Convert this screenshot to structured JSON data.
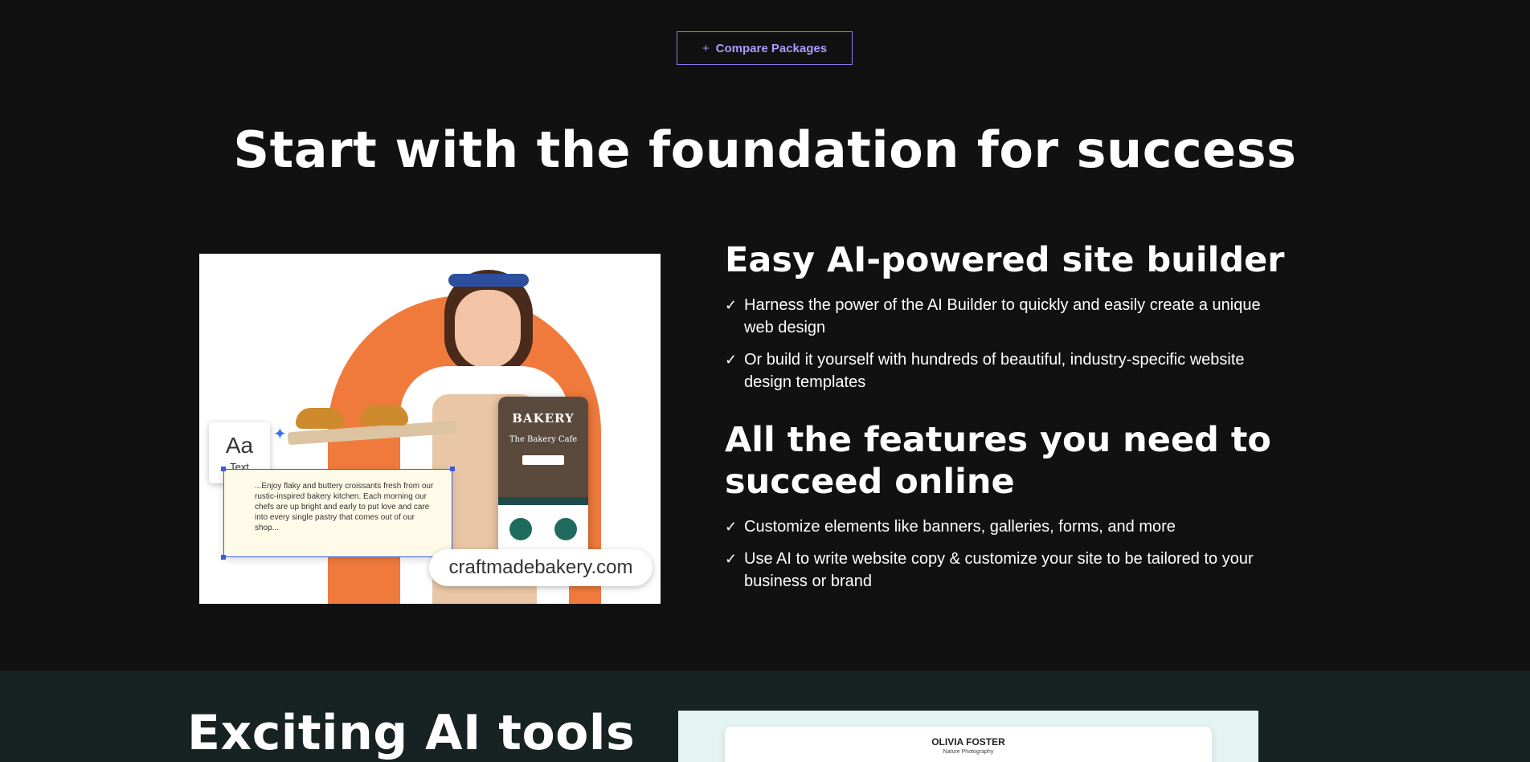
{
  "top_button": {
    "icon": "+",
    "label": "Compare Packages"
  },
  "hero": {
    "title": "Start with the foundation for success"
  },
  "image": {
    "text_tool_glyph": "Aa",
    "text_tool_label": "Text",
    "copy_text": "...Enjoy flaky and buttery croissants fresh from our rustic-inspired bakery kitchen. Each morning our chefs are up bright and early to put love and care into every single pastry that comes out of our shop...",
    "phone_brand": "BAKERY",
    "phone_sub": "The Bakery Cafe",
    "domain": "craftmadebakery.com"
  },
  "section1": {
    "heading": "Easy AI-powered site builder",
    "items": [
      "Harness the power of the AI Builder to quickly and easily create a unique web design",
      "Or build it yourself with hundreds of beautiful, industry-specific website design templates"
    ]
  },
  "section2": {
    "heading_line1": "All the features you need to",
    "heading_line2": "succeed online",
    "items": [
      "Customize elements like banners, galleries, forms, and more",
      "Use AI to write website copy & customize your site to be tailored to your business or brand"
    ]
  },
  "lower": {
    "title": "Exciting AI tools",
    "preview_name": "OLIVIA FOSTER",
    "preview_sub": "Nature Photography"
  },
  "colors": {
    "background": "#111111",
    "accent": "#8b7cf6",
    "lower_bg": "#172222",
    "arch": "#f07a3c"
  }
}
